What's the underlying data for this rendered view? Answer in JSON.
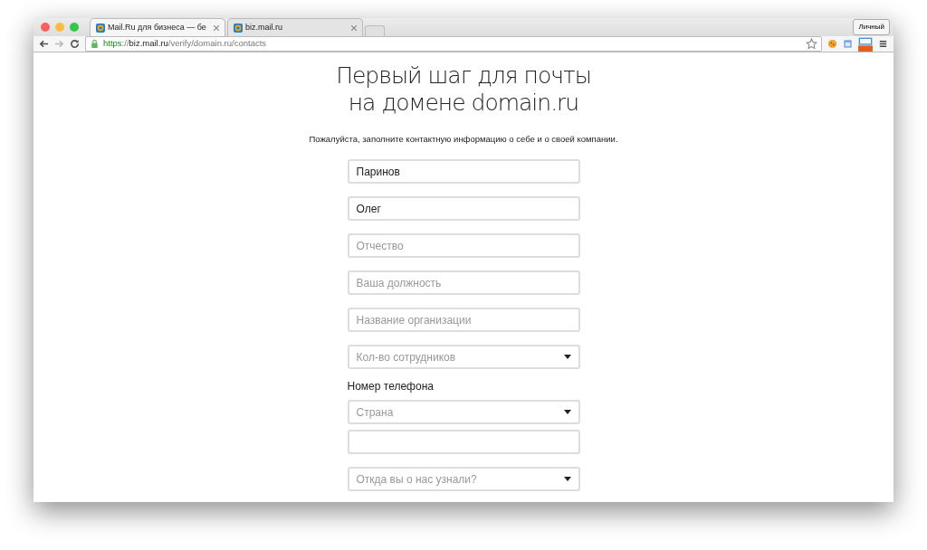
{
  "browser": {
    "tabs": [
      {
        "title": "Mail.Ru для бизнеса — бе",
        "selected": true
      },
      {
        "title": "biz.mail.ru",
        "selected": false
      }
    ],
    "profile_button": "Личный",
    "url_parts": [
      {
        "text": "https",
        "kind": "secure"
      },
      {
        "text": "://",
        "kind": "dim"
      },
      {
        "text": "biz.mail.ru",
        "kind": "host"
      },
      {
        "text": "/verify/domain.ru/contacts",
        "kind": "dim"
      }
    ]
  },
  "page": {
    "title_lines": [
      "Первый шаг для почты",
      "на домене domain.ru"
    ],
    "subtitle": "Пожалуйста, заполните контактную информацию о себе и о своей компании.",
    "fields": [
      {
        "kind": "input",
        "value": "Паринов"
      },
      {
        "kind": "input",
        "value": "Олег"
      },
      {
        "kind": "input",
        "placeholder": "Отчество"
      },
      {
        "kind": "input",
        "placeholder": "Ваша должность"
      },
      {
        "kind": "input",
        "placeholder": "Название организации"
      },
      {
        "kind": "select",
        "placeholder": "Кол-во сотрудников"
      },
      {
        "kind": "label",
        "text": "Номер телефона"
      },
      {
        "kind": "select",
        "placeholder": "Страна"
      },
      {
        "kind": "input"
      },
      {
        "kind": "select",
        "placeholder": "Откда вы о нас узнали?"
      }
    ]
  }
}
